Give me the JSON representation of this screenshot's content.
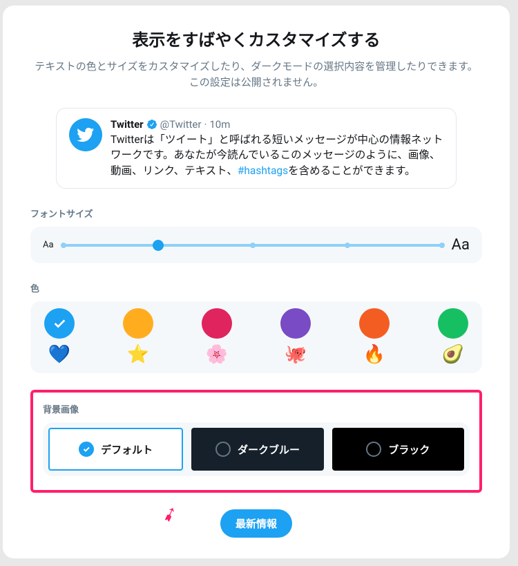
{
  "dialog": {
    "title": "表示をすばやくカスタマイズする",
    "subtitle": "テキストの色とサイズをカスタマイズしたり、ダークモードの選択内容を管理したりできます。この設定は公開されません。"
  },
  "tweet": {
    "name": "Twitter",
    "handle": "@Twitter",
    "separator": "·",
    "time": "10m",
    "text_before": "Twitterは「ツイート」と呼ばれる短いメッセージが中心の情報ネットワークです。あなたが今読んでいるこのメッセージのように、画像、動画、リンク、テキスト、",
    "hashtag": "#hashtags",
    "text_after": "を含めることができます。"
  },
  "fontsize": {
    "label": "フォントサイズ",
    "small": "Aa",
    "large": "Aa",
    "stops": 5,
    "selected_index": 1
  },
  "color": {
    "label": "色",
    "options": [
      {
        "hex": "#1da1f2",
        "emoji": "💙",
        "selected": true
      },
      {
        "hex": "#ffad1f",
        "emoji": "⭐",
        "selected": false
      },
      {
        "hex": "#e0245e",
        "emoji": "🌸",
        "selected": false
      },
      {
        "hex": "#794bc4",
        "emoji": "🐙",
        "selected": false
      },
      {
        "hex": "#f45d22",
        "emoji": "🔥",
        "selected": false
      },
      {
        "hex": "#17bf63",
        "emoji": "🥑",
        "selected": false
      }
    ]
  },
  "background": {
    "label": "背景画像",
    "options": [
      {
        "label": "デフォルト",
        "selected": true
      },
      {
        "label": "ダークブルー",
        "selected": false
      },
      {
        "label": "ブラック",
        "selected": false
      }
    ]
  },
  "footer": {
    "button": "最新情報"
  }
}
